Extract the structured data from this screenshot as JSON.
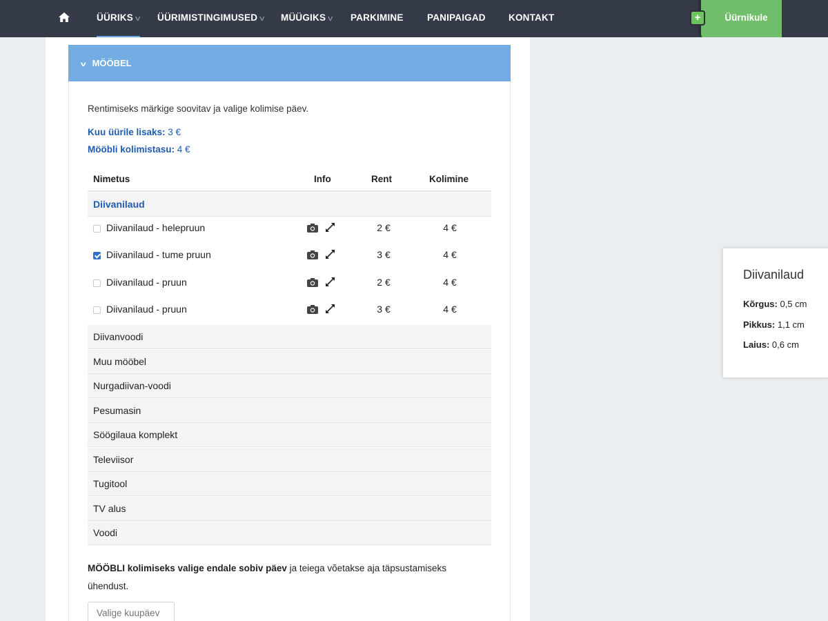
{
  "nav": {
    "items": [
      {
        "label": "ÜÜRIKS",
        "dropdown": true,
        "active": true
      },
      {
        "label": "ÜÜRIMISTINGIMUSED",
        "dropdown": true
      },
      {
        "label": "MÜÜGIKS",
        "dropdown": true
      },
      {
        "label": "PARKIMINE"
      },
      {
        "label": "PANIPAIGAD"
      },
      {
        "label": "KONTAKT"
      }
    ],
    "plus_label": "+",
    "tenant_label": "Üürnikule"
  },
  "panel": {
    "title": "MÖÖBEL",
    "intro": "Rentimiseks märkige soovitav ja valige kolimise päev.",
    "monthly_label": "Kuu üürile lisaks:",
    "monthly_value": "3 €",
    "moving_label": "Mööbli kolimistasu:",
    "moving_value": "4 €"
  },
  "table": {
    "headers": {
      "name": "Nimetus",
      "info": "Info",
      "rent": "Rent",
      "move": "Kolimine"
    },
    "open_category": "Diivanilaud",
    "items": [
      {
        "name": "Diivanilaud - helepruun",
        "rent": "2 €",
        "move": "4 €",
        "checked": false
      },
      {
        "name": "Diivanilaud - tume pruun",
        "rent": "3 €",
        "move": "4 €",
        "checked": true
      },
      {
        "name": "Diivanilaud - pruun",
        "rent": "2 €",
        "move": "4 €",
        "checked": false
      },
      {
        "name": "Diivanilaud - pruun",
        "rent": "3 €",
        "move": "4 €",
        "checked": false
      }
    ],
    "categories": [
      "Diivanvoodi",
      "Muu mööbel",
      "Nurgadiivan-voodi",
      "Pesumasin",
      "Söögilaua komplekt",
      "Televiisor",
      "Tugitool",
      "TV alus",
      "Voodi"
    ]
  },
  "footer": {
    "bold_text": "MÖÖBLI kolimiseks valige endale sobiv päev",
    "rest_text": " ja teiega võetakse aja täpsustamiseks ühendust.",
    "date_placeholder": "Valige kuupäev"
  },
  "popup": {
    "title": "Diivanilaud",
    "height_label": "Kõrgus:",
    "height_value": "0,5 cm",
    "length_label": "Pikkus:",
    "length_value": "1,1 cm",
    "width_label": "Laius:",
    "width_value": "0,6 cm"
  },
  "colors": {
    "nav_bg": "#343a48",
    "panel_header": "#72ace3",
    "accent_blue": "#1e5cb3",
    "tenant_green": "#70bd6b"
  },
  "icons": [
    "home-icon",
    "chevron-down-icon",
    "plus-icon",
    "camera-icon",
    "expand-icon",
    "checkbox-icon"
  ]
}
